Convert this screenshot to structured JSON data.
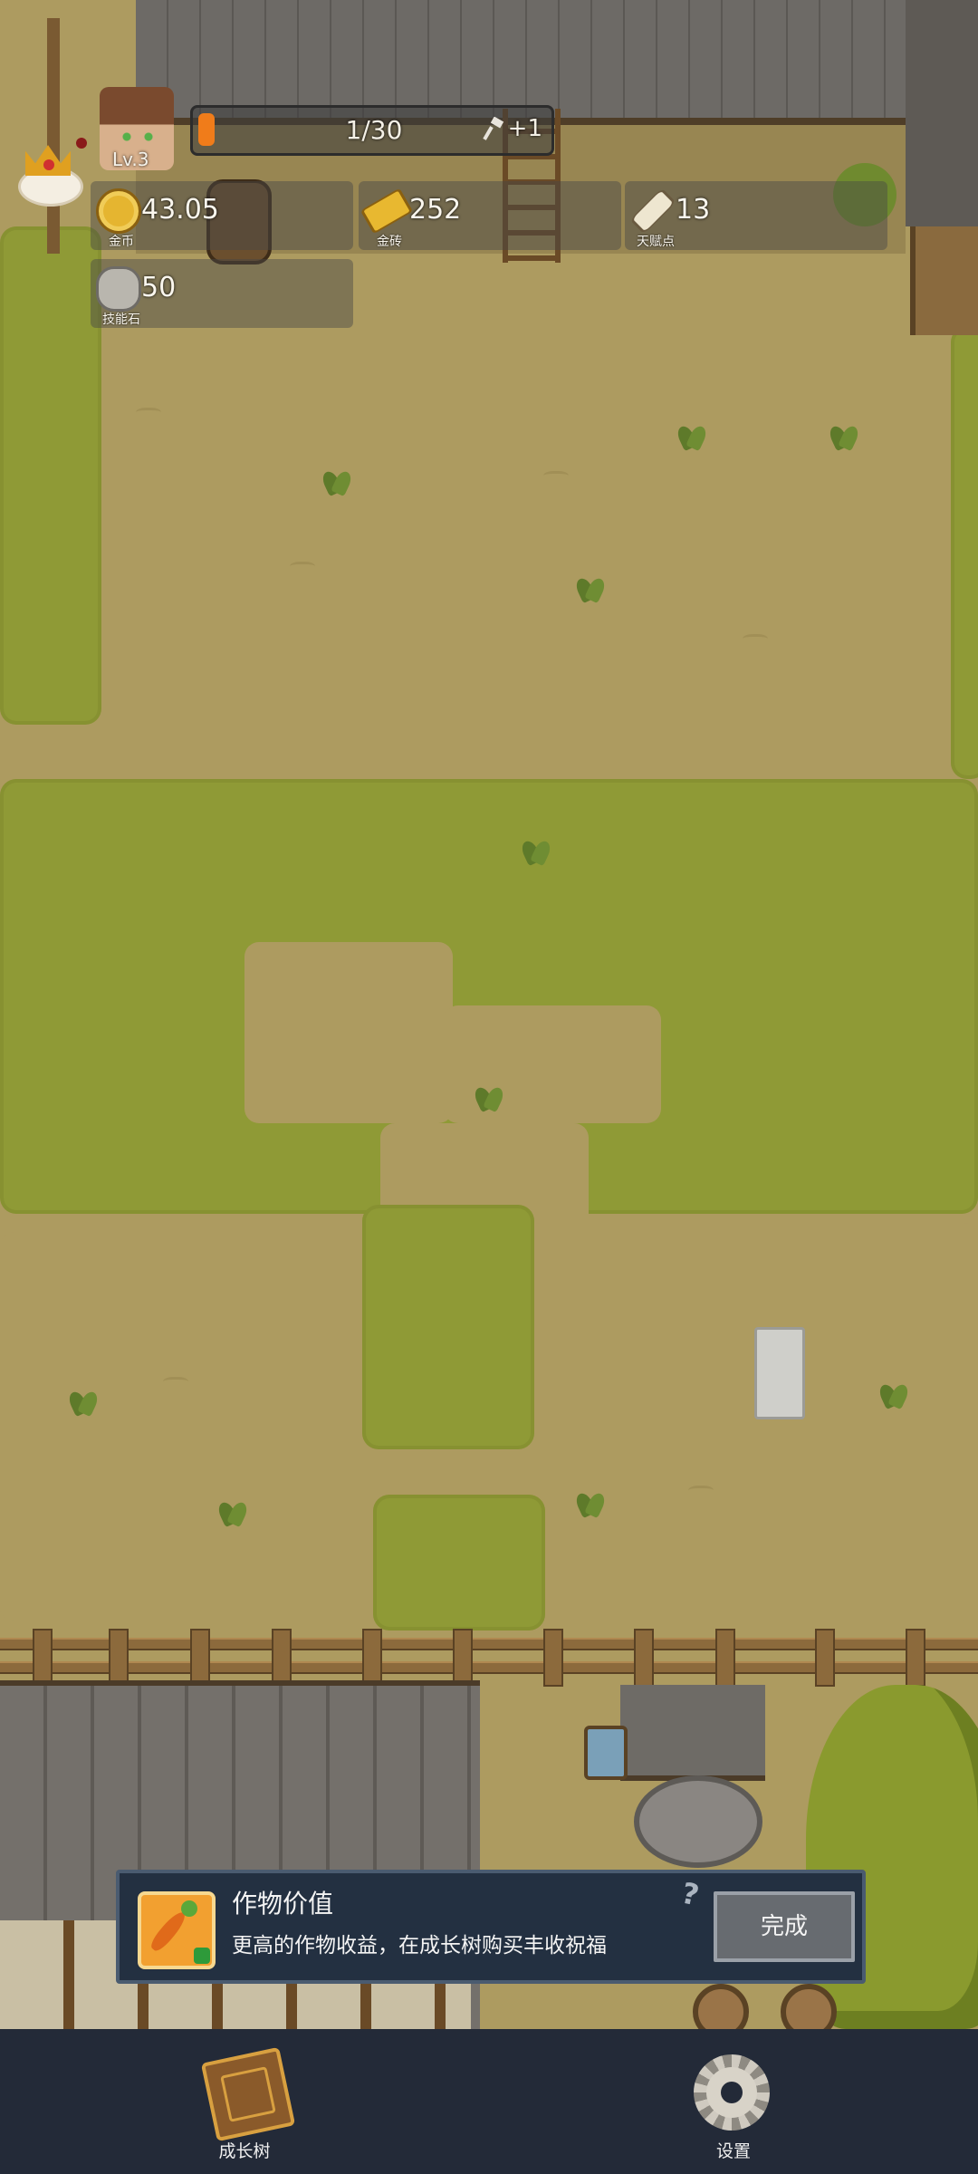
{
  "hud": {
    "level": "Lv.3",
    "energy": {
      "text": "1/30",
      "bonus": "+1",
      "fraction": 0.033
    },
    "resources": [
      {
        "icon": "gold-coin-icon",
        "value": "43.05",
        "label": "金币"
      },
      {
        "icon": "gold-bar-icon",
        "value": "252",
        "label": "金砖"
      },
      {
        "icon": "talent-scroll-icon",
        "value": "13",
        "label": "天赋点"
      },
      {
        "icon": "skill-stone-icon",
        "value": "50",
        "label": "技能石"
      }
    ]
  },
  "task": {
    "icon": "carrot-icon",
    "title": "作物价值",
    "description": "更高的作物收益，在成长树购买丰收祝福",
    "help": "?",
    "button": "完成"
  },
  "nav": [
    {
      "icon": "book-icon",
      "label": "成长树"
    },
    {
      "icon": "gear-icon",
      "label": "设置"
    }
  ],
  "colors": {
    "grass": "#8f9a36",
    "dirt": "#ad9b60",
    "panel": "#233041",
    "bottom_bar": "#232a38",
    "energy": "#f07c1a"
  }
}
